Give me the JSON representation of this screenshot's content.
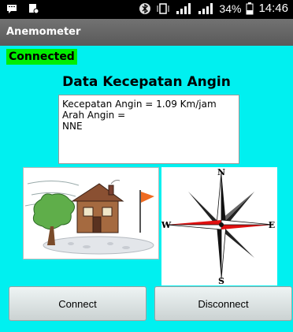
{
  "status_bar": {
    "battery": "34%",
    "time": "14:46",
    "icons": [
      "chat-icon",
      "notification-icon",
      "bluetooth-icon",
      "vibrate-icon",
      "signal-icon",
      "signal-icon",
      "battery-icon"
    ]
  },
  "app": {
    "title": "Anemometer"
  },
  "connection": {
    "status": "Connected"
  },
  "main": {
    "heading": "Data Kecepatan Angin",
    "speed_line": "Kecepatan Angin = 1.09 Km/jam",
    "direction_label": "Arah Angin =",
    "direction_value": "NNE"
  },
  "compass": {
    "n": "N",
    "s": "S",
    "e": "E",
    "w": "W"
  },
  "buttons": {
    "connect": "Connect",
    "disconnect": "Disconnect"
  },
  "colors": {
    "background": "#00f0f0",
    "connected_badge": "#00ee00",
    "compass_red": "#e01010"
  }
}
